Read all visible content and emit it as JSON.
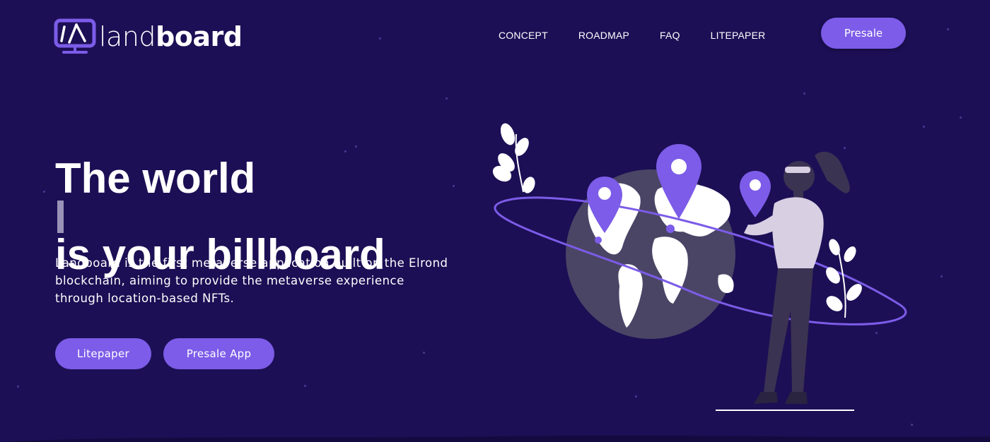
{
  "brand": {
    "logo_text_light": "land",
    "logo_text_bold": "board"
  },
  "nav": {
    "items": [
      {
        "label": "CONCEPT"
      },
      {
        "label": "ROADMAP"
      },
      {
        "label": "FAQ"
      },
      {
        "label": "LITEPAPER"
      }
    ],
    "presale_label": "Presale"
  },
  "hero": {
    "headline_line1": "The world",
    "headline_line2": "is your billboard",
    "description": "Landboard is the first metaverse application built on the Elrond blockchain, aiming to provide the metaverse experience through location-based NFTs.",
    "buttons": [
      {
        "label": "Litepaper"
      },
      {
        "label": "Presale App"
      }
    ]
  },
  "illustration": {
    "icon": "globe-map-pins-woman-illustration"
  },
  "colors": {
    "background": "#1c0f55",
    "accent": "#7c5ce8",
    "globe": "#4a4565",
    "continents": "#ffffff",
    "pin": "#7c5ce8",
    "sweater": "#d8cfe3",
    "pants": "#3b3352"
  }
}
